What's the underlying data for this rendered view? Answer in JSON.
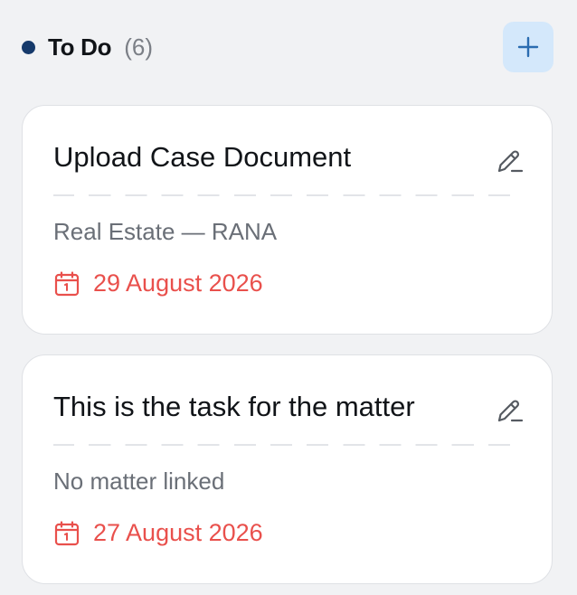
{
  "column": {
    "title": "To Do",
    "count": "(6)",
    "dot_color": "#163a6b",
    "add_icon": "plus-icon"
  },
  "tasks": [
    {
      "title": "Upload Case Document",
      "matter": "Real Estate — RANA",
      "due_date": "29 August 2026",
      "edit_icon": "pencil-icon",
      "date_icon": "calendar-icon"
    },
    {
      "title": "This is the task for the matter",
      "matter": "No matter linked",
      "due_date": "27 August 2026",
      "edit_icon": "pencil-icon",
      "date_icon": "calendar-icon"
    }
  ],
  "colors": {
    "accent": "#2b6cb0",
    "due": "#e9504c",
    "add_button_bg": "#d4e8fb"
  }
}
